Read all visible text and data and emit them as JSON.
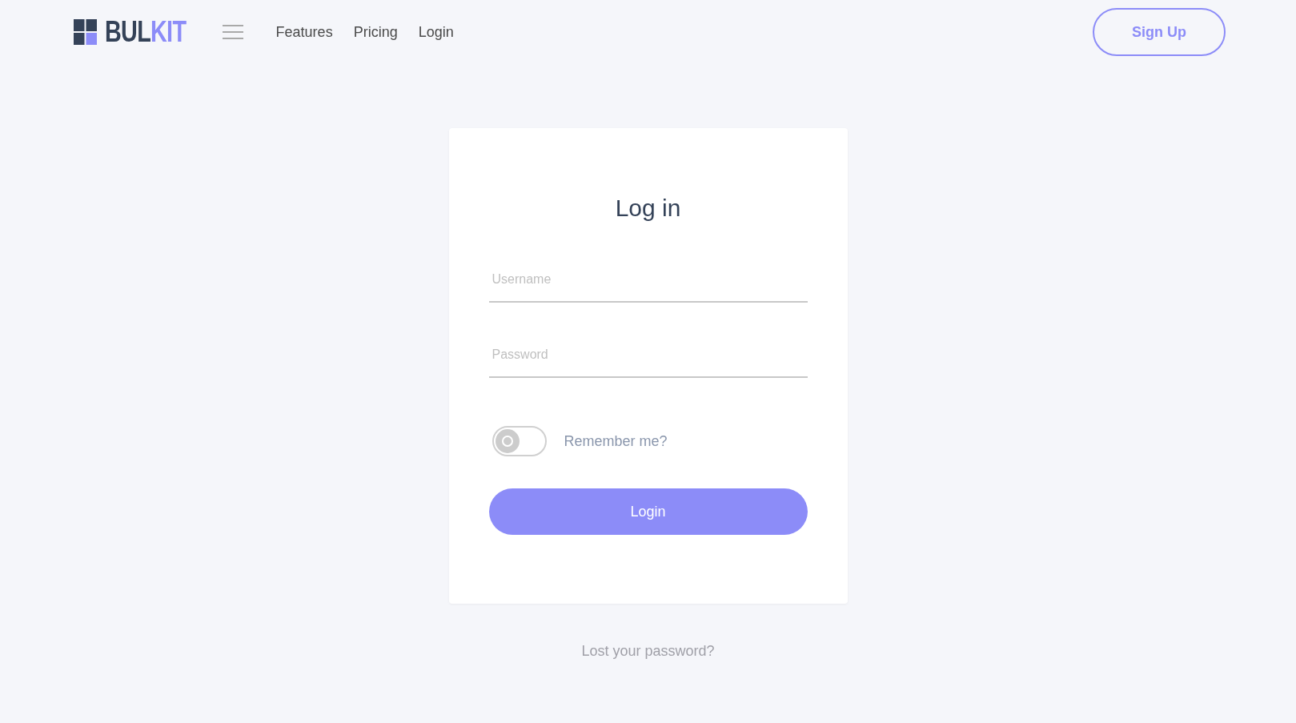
{
  "header": {
    "logo": {
      "part_1": "BUL",
      "part_2": "KIT"
    },
    "nav": [
      "Features",
      "Pricing",
      "Login"
    ],
    "signup_button": "Sign Up"
  },
  "login_card": {
    "title": "Log in",
    "fields": [
      {
        "placeholder": "Username"
      },
      {
        "placeholder": "Password"
      }
    ],
    "remember": {
      "label": "Remember me?",
      "on": false
    },
    "submit": "Login"
  },
  "lost_password": "Lost your password?"
}
